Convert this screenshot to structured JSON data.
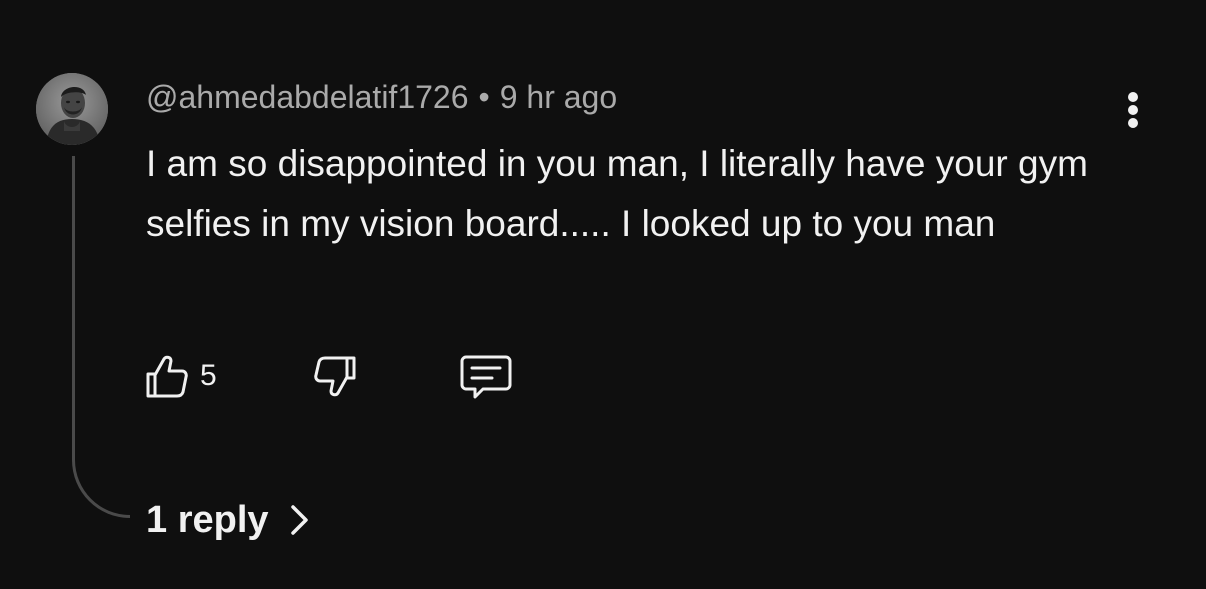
{
  "comment": {
    "author": "@ahmedabdelatif1726",
    "separator": "•",
    "time": "9 hr ago",
    "text": "I am so disappointed in you man, I literally have your gym selfies in my vision board..... I looked up to you man",
    "avatar_icon": "user-avatar-photo",
    "more_icon": "more-vertical-icon",
    "actions": {
      "like_icon": "thumbs-up-icon",
      "like_count": "5",
      "dislike_icon": "thumbs-down-icon",
      "reply_icon": "comment-icon"
    },
    "replies": {
      "label": "1 reply",
      "icon": "chevron-right-icon"
    }
  },
  "colors": {
    "background": "#0f0f0f",
    "text": "#f1f1f1",
    "secondary_text": "#aaaaaa",
    "thread_line": "#4a4a4a"
  }
}
